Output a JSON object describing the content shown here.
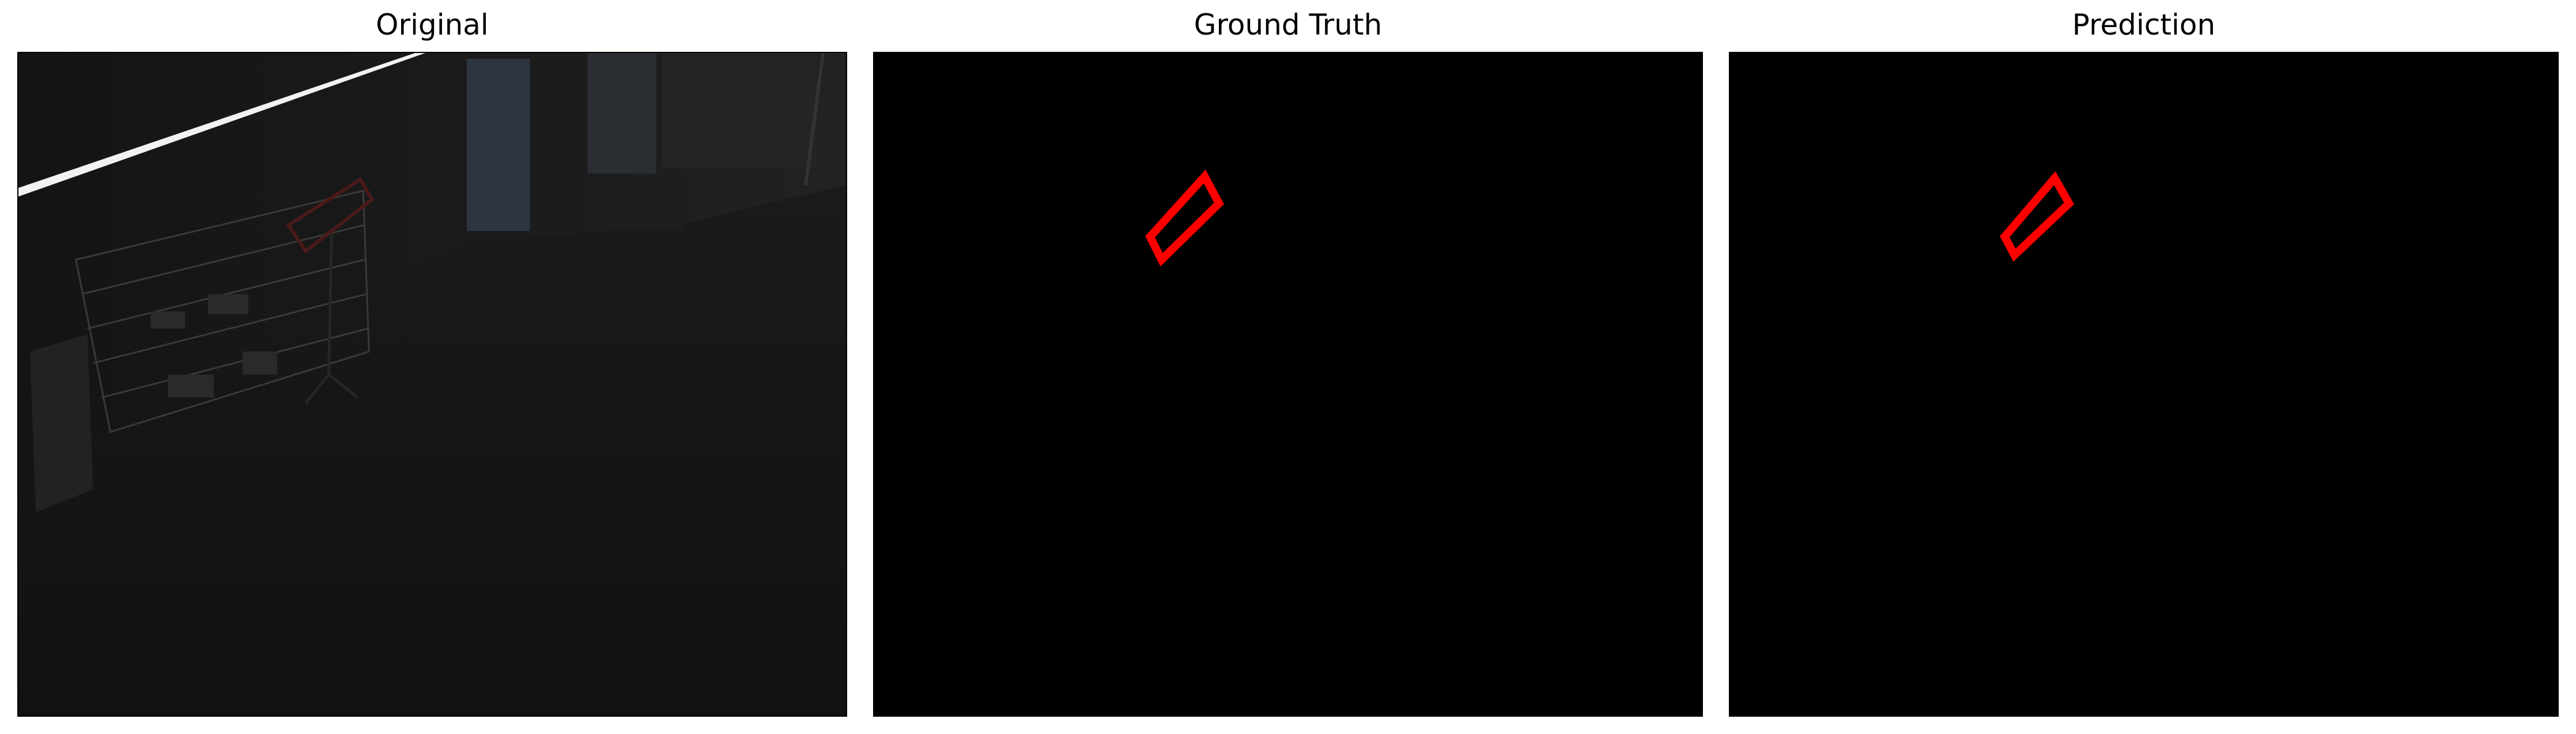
{
  "panels": [
    {
      "id": "original",
      "title": "Original"
    },
    {
      "id": "ground_truth",
      "title": "Ground Truth"
    },
    {
      "id": "prediction",
      "title": "Prediction"
    }
  ],
  "colors": {
    "mask_background": "#000000",
    "box_outline": "#ff0000",
    "original_tint": "#151515"
  }
}
